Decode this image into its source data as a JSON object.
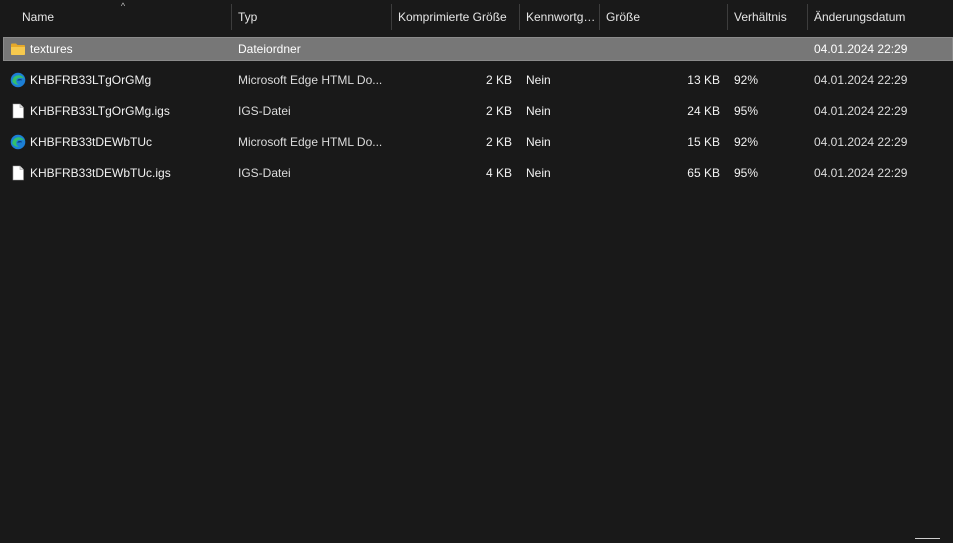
{
  "columns": {
    "name": "Name",
    "type": "Typ",
    "compressed": "Komprimierte Größe",
    "password": "Kennwortg…",
    "size": "Größe",
    "ratio": "Verhältnis",
    "modified": "Änderungsdatum"
  },
  "sort_indicator": "^",
  "rows": [
    {
      "icon": "folder-icon",
      "name": "textures",
      "type": "Dateiordner",
      "compressed": "",
      "password": "",
      "size": "",
      "ratio": "",
      "modified": "04.01.2024 22:29",
      "selected": true
    },
    {
      "icon": "edge-icon",
      "name": "KHBFRB33LTgOrGMg",
      "type": "Microsoft Edge HTML Do...",
      "compressed": "2 KB",
      "password": "Nein",
      "size": "13 KB",
      "ratio": "92%",
      "modified": "04.01.2024 22:29",
      "selected": false
    },
    {
      "icon": "file-icon",
      "name": "KHBFRB33LTgOrGMg.igs",
      "type": "IGS-Datei",
      "compressed": "2 KB",
      "password": "Nein",
      "size": "24 KB",
      "ratio": "95%",
      "modified": "04.01.2024 22:29",
      "selected": false
    },
    {
      "icon": "edge-icon",
      "name": "KHBFRB33tDEWbTUc",
      "type": "Microsoft Edge HTML Do...",
      "compressed": "2 KB",
      "password": "Nein",
      "size": "15 KB",
      "ratio": "92%",
      "modified": "04.01.2024 22:29",
      "selected": false
    },
    {
      "icon": "file-icon",
      "name": "KHBFRB33tDEWbTUc.igs",
      "type": "IGS-Datei",
      "compressed": "4 KB",
      "password": "Nein",
      "size": "65 KB",
      "ratio": "95%",
      "modified": "04.01.2024 22:29",
      "selected": false
    }
  ],
  "colors": {
    "background": "#191919",
    "selection": "#777777",
    "folder": "#f4c54a",
    "edge_blue": "#1c7fd6",
    "edge_green": "#38c172"
  }
}
